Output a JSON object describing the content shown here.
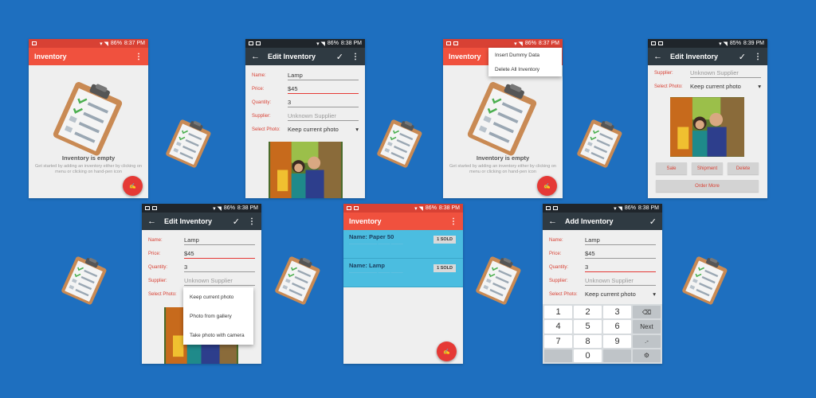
{
  "status": {
    "s1": {
      "battery": "86%",
      "time": "8:37 PM"
    },
    "s2": {
      "battery": "86%",
      "time": "8:38 PM"
    },
    "s3": {
      "battery": "86%",
      "time": "8:37 PM"
    },
    "s4": {
      "battery": "85%",
      "time": "8:39 PM"
    },
    "s5": {
      "battery": "86%",
      "time": "8:38 PM"
    },
    "s6": {
      "battery": "86%",
      "time": "8:38 PM"
    },
    "s7": {
      "battery": "86%",
      "time": "8:38 PM"
    }
  },
  "screen1": {
    "title": "Inventory",
    "empty_title": "Inventory is empty",
    "empty_sub": "Get started by adding an inventory either by clicking on menu or clicking on hand-pen icon"
  },
  "screen2": {
    "title": "Edit Inventory",
    "fields": {
      "name_label": "Name:",
      "name": "Lamp",
      "price_label": "Price:",
      "price": "$45",
      "quantity_label": "Quantity:",
      "quantity": "3",
      "supplier_label": "Supplier:",
      "supplier_placeholder": "Unknown Supplier",
      "photo_label": "Select Photo:",
      "photo": "Keep current photo"
    }
  },
  "screen3": {
    "title": "Inventory",
    "menu": [
      "Insert Dummy Data",
      "Delete All Inventory"
    ],
    "empty_title": "Inventory is empty",
    "empty_sub": "Get started by adding an inventory either by clicking on menu or clicking on hand-pen icon"
  },
  "screen4": {
    "title": "Edit Inventory",
    "supplier_label": "Supplier:",
    "supplier_placeholder": "Unknown Supplier",
    "photo_label": "Select Photo:",
    "photo": "Keep current photo",
    "buttons": {
      "sale": "Sale",
      "shipment": "Shipment",
      "delete": "Delete",
      "order": "Order More"
    }
  },
  "screen5": {
    "title": "Edit Inventory",
    "fields": {
      "name_label": "Name:",
      "name": "Lamp",
      "price_label": "Price:",
      "price": "$45",
      "quantity_label": "Quantity:",
      "quantity": "3",
      "supplier_label": "Supplier:",
      "supplier_placeholder": "Unknown Supplier",
      "photo_label": "Select Photo:"
    },
    "photo_options": [
      "Keep current photo",
      "Photo from gallery",
      "Take photo with camera"
    ]
  },
  "screen6": {
    "title": "Inventory",
    "items": [
      {
        "name": "Name: Paper 50",
        "sold": "1 SOLD"
      },
      {
        "name": "Name: Lamp",
        "sold": "1 SOLD"
      }
    ]
  },
  "screen7": {
    "title": "Add Inventory",
    "fields": {
      "name_label": "Name:",
      "name": "Lamp",
      "price_label": "Price:",
      "price": "$45",
      "quantity_label": "Quantity:",
      "quantity": "3",
      "supplier_label": "Supplier:",
      "supplier_placeholder": "Unknown Supplier",
      "photo_label": "Select Photo:",
      "photo": "Keep current photo"
    },
    "keys": [
      "1",
      "2",
      "3",
      "⌫",
      "4",
      "5",
      "6",
      "Next",
      "7",
      "8",
      "9",
      ".-",
      "",
      "0",
      "",
      "⚙"
    ]
  },
  "colors": {
    "background": "#1e6fbf",
    "accent_red": "#f0513e",
    "dark_bar": "#2f3a42",
    "card_blue": "#4bbde0"
  },
  "icons": [
    "clipboard-icon",
    "hand-pen-icon",
    "back-arrow-icon",
    "check-icon",
    "overflow-menu-icon",
    "backspace-icon",
    "settings-icon",
    "dropdown-arrow-icon"
  ]
}
